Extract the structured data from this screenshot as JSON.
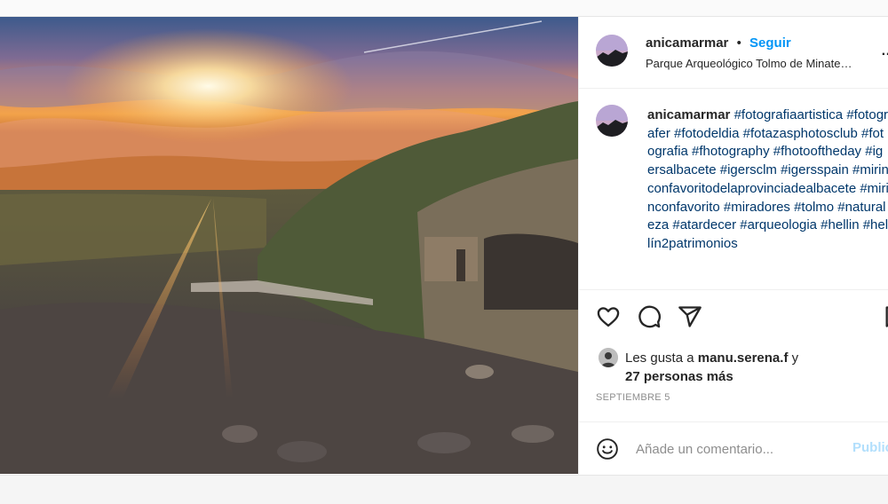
{
  "post": {
    "username": "anicamarmar",
    "follow_label": "Seguir",
    "dot": "•",
    "location": "Parque Arqueológico Tolmo de Minate…",
    "more_icon": "…",
    "caption": {
      "username": "anicamarmar",
      "hashtags": [
        "#fotografiaartistica",
        "#fotografer",
        "#fotodeldia",
        "#fotazasphotosclub",
        "#fotografia",
        "#fhotography",
        "#fhotooftheday",
        "#igersalbacete",
        "#igersclm",
        "#igersspain",
        "#mirinconfavoritodelaprovinciadealbacete",
        "#mirinconfavorito",
        "#miradores",
        "#tolmo",
        "#naturaleza",
        "#atardecer",
        "#arqueologia",
        "#hellin",
        "#hellín2patrimonios"
      ]
    },
    "actions": {
      "like_icon": "heart-icon",
      "comment_icon": "comment-icon",
      "share_icon": "share-icon",
      "save_icon": "bookmark-icon"
    },
    "likes": {
      "prefix": "Les gusta a",
      "user": "manu.serena.f",
      "connector": "y",
      "others": "27 personas más"
    },
    "date": "SEPTIEMBRE 5",
    "comment": {
      "placeholder": "Añade un comentario...",
      "publish_label": "Publicar"
    }
  },
  "colors": {
    "link_blue": "#0095f6",
    "hashtag": "#00376b",
    "publish_disabled": "#b2dffc"
  }
}
